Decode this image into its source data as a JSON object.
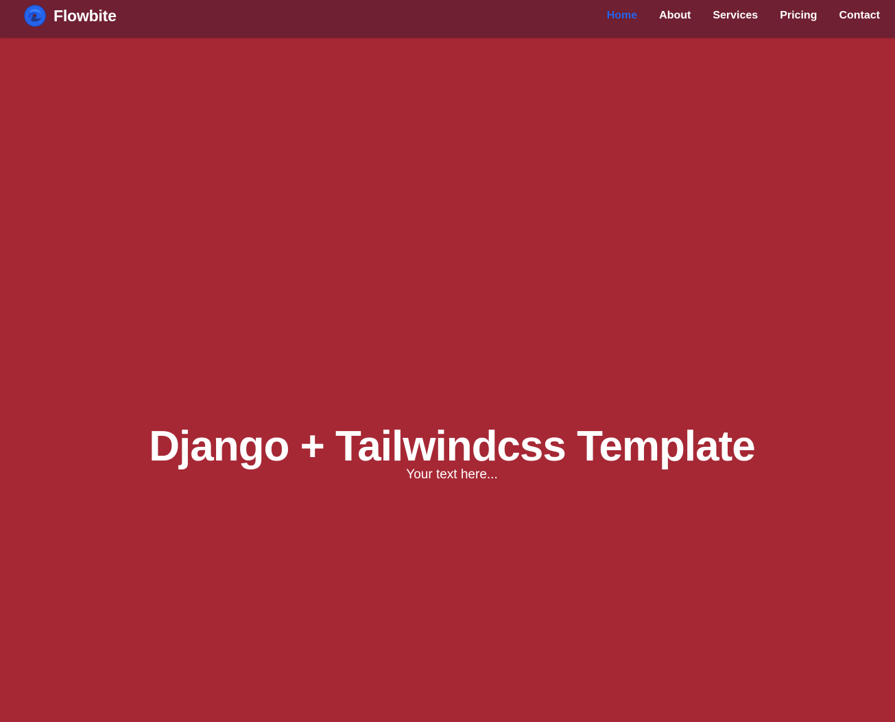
{
  "navbar": {
    "brand": {
      "name": "Flowbite",
      "logo_icon": "flowbite-logo-icon"
    },
    "links": [
      {
        "label": "Home",
        "active": true
      },
      {
        "label": "About",
        "active": false
      },
      {
        "label": "Services",
        "active": false
      },
      {
        "label": "Pricing",
        "active": false
      },
      {
        "label": "Contact",
        "active": false
      }
    ]
  },
  "hero": {
    "title": "Django + Tailwindcss Template",
    "subtitle": "Your text here..."
  },
  "colors": {
    "page_background": "#a62835",
    "navbar_background": "#6f2032",
    "active_link": "#2563eb",
    "text": "#ffffff"
  }
}
